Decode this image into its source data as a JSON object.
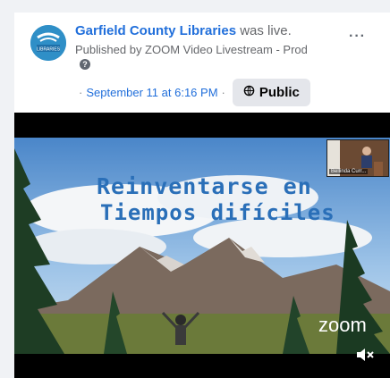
{
  "post": {
    "page_name": "Garfield County Libraries",
    "status": " was live.",
    "published_by": "Published by ZOOM Video Livestream - Prod",
    "date": "September 11 at 6:16 PM",
    "dot": "·",
    "privacy": "Public",
    "more": "···"
  },
  "video": {
    "title_line1": "Reinventarse en",
    "title_line2": "Tiempos difíciles",
    "watermark": "zoom",
    "pip_name": "Bellinda Curr..."
  },
  "avatar": {
    "label": "LIBRARIES"
  },
  "colors": {
    "link": "#216fdb",
    "meta": "#65676b",
    "button_bg": "#e4e6eb",
    "avatar_bg": "#2f8fc7"
  },
  "icons": {
    "help": "question-icon",
    "privacy": "globe-icon",
    "more": "more-options-icon",
    "mute": "muted-speaker-icon"
  }
}
